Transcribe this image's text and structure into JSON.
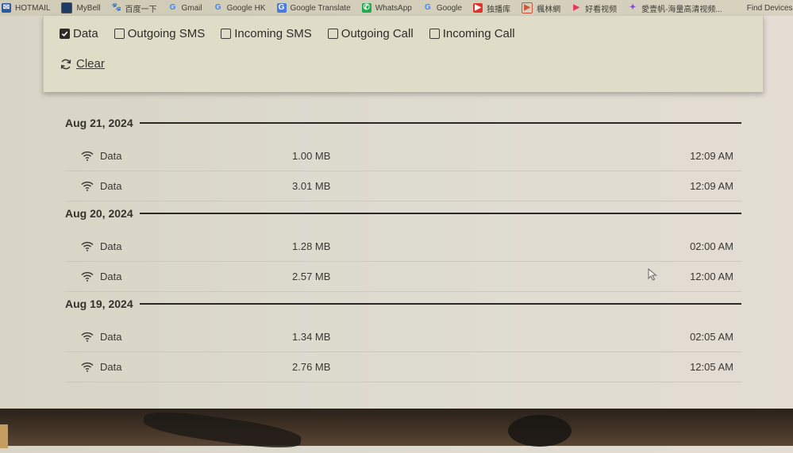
{
  "bookmarks": [
    {
      "label": "HOTMAIL",
      "icon": "hotmail-icon"
    },
    {
      "label": "MyBell",
      "icon": "mybell-icon"
    },
    {
      "label": "百度一下",
      "icon": "baidu-icon"
    },
    {
      "label": "Gmail",
      "icon": "google-icon"
    },
    {
      "label": "Google HK",
      "icon": "google-icon"
    },
    {
      "label": "Google Translate",
      "icon": "google-translate-icon"
    },
    {
      "label": "WhatsApp",
      "icon": "whatsapp-icon"
    },
    {
      "label": "Google",
      "icon": "google-icon"
    },
    {
      "label": "独播库",
      "icon": "play-icon"
    },
    {
      "label": "楓林網",
      "icon": "play-circle-icon"
    },
    {
      "label": "好看视频",
      "icon": "play-heart-icon"
    },
    {
      "label": "愛壹帆-海量高清视频...",
      "icon": "aiyifan-icon"
    },
    {
      "label": "Find Devices",
      "icon": "apple-icon"
    }
  ],
  "filters": {
    "options": [
      {
        "label": "Data",
        "checked": true
      },
      {
        "label": "Outgoing SMS",
        "checked": false
      },
      {
        "label": "Incoming SMS",
        "checked": false
      },
      {
        "label": "Outgoing Call",
        "checked": false
      },
      {
        "label": "Incoming Call",
        "checked": false
      }
    ],
    "clear_label": "Clear"
  },
  "groups": [
    {
      "date": "Aug 21, 2024",
      "rows": [
        {
          "type": "Data",
          "size": "1.00 MB",
          "time": "12:09 AM"
        },
        {
          "type": "Data",
          "size": "3.01 MB",
          "time": "12:09 AM"
        }
      ]
    },
    {
      "date": "Aug 20, 2024",
      "rows": [
        {
          "type": "Data",
          "size": "1.28 MB",
          "time": "02:00 AM"
        },
        {
          "type": "Data",
          "size": "2.57 MB",
          "time": "12:00 AM"
        }
      ]
    },
    {
      "date": "Aug 19, 2024",
      "rows": [
        {
          "type": "Data",
          "size": "1.34 MB",
          "time": "02:05 AM"
        },
        {
          "type": "Data",
          "size": "2.76 MB",
          "time": "12:05 AM"
        }
      ]
    }
  ]
}
